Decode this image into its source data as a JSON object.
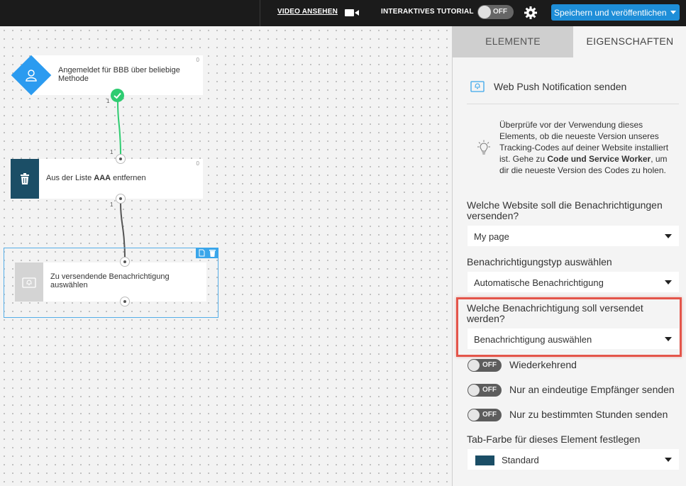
{
  "topbar": {
    "video_label": "VIDEO ANSEHEN",
    "tutorial_label": "INTERAKTIVES TUTORIAL",
    "tutorial_toggle": "OFF",
    "save_label": "Speichern und veröffentlichen"
  },
  "workflow": {
    "nodes": [
      {
        "label": "Angemeldet für BBB über beliebige Methode",
        "count": "0",
        "icon": "user-icon"
      },
      {
        "label_prefix": "Aus der Liste ",
        "label_bold": "AAA",
        "label_suffix": " entfernen",
        "count": "0",
        "icon": "trash-icon"
      },
      {
        "label": "Zu versendende Benachrichtigung auswählen",
        "icon": "bell-icon"
      }
    ],
    "connector_labels": [
      "1",
      "1",
      "1"
    ]
  },
  "panel": {
    "tabs": [
      {
        "label": "ELEMENTE",
        "active": false
      },
      {
        "label": "EIGENSCHAFTEN",
        "active": true
      }
    ],
    "title": "Web Push Notification senden",
    "info": {
      "text_before": "Überprüfe vor der Verwendung dieses Elements, ob die neueste Version unseres Tracking-Codes auf deiner Website installiert ist. Gehe zu ",
      "text_bold": "Code und Service Worker",
      "text_after": ", um dir die neueste Version des Codes zu holen."
    },
    "website_question": "Welche Website soll die Benachrichtigungen versenden?",
    "website_value": "My page",
    "type_question": "Benachrichtigungstyp auswählen",
    "type_value": "Automatische Benachrichtigung",
    "notification_question": "Welche Benachrichtigung soll versendet werden?",
    "notification_value": "Benachrichtigung auswählen",
    "toggles": [
      {
        "state": "OFF",
        "label": "Wiederkehrend"
      },
      {
        "state": "OFF",
        "label": "Nur an eindeutige Empfänger senden"
      },
      {
        "state": "OFF",
        "label": "Nur zu bestimmten Stunden senden"
      }
    ],
    "color_question": "Tab-Farbe für dieses Element festlegen",
    "color_value": "Standard",
    "color_swatch": "#1b4e66"
  },
  "colors": {
    "accent": "#1e8ed8",
    "success": "#2ecc71",
    "highlight": "#e4554a",
    "trigger": "#2196f3",
    "action": "#1b4e66"
  }
}
